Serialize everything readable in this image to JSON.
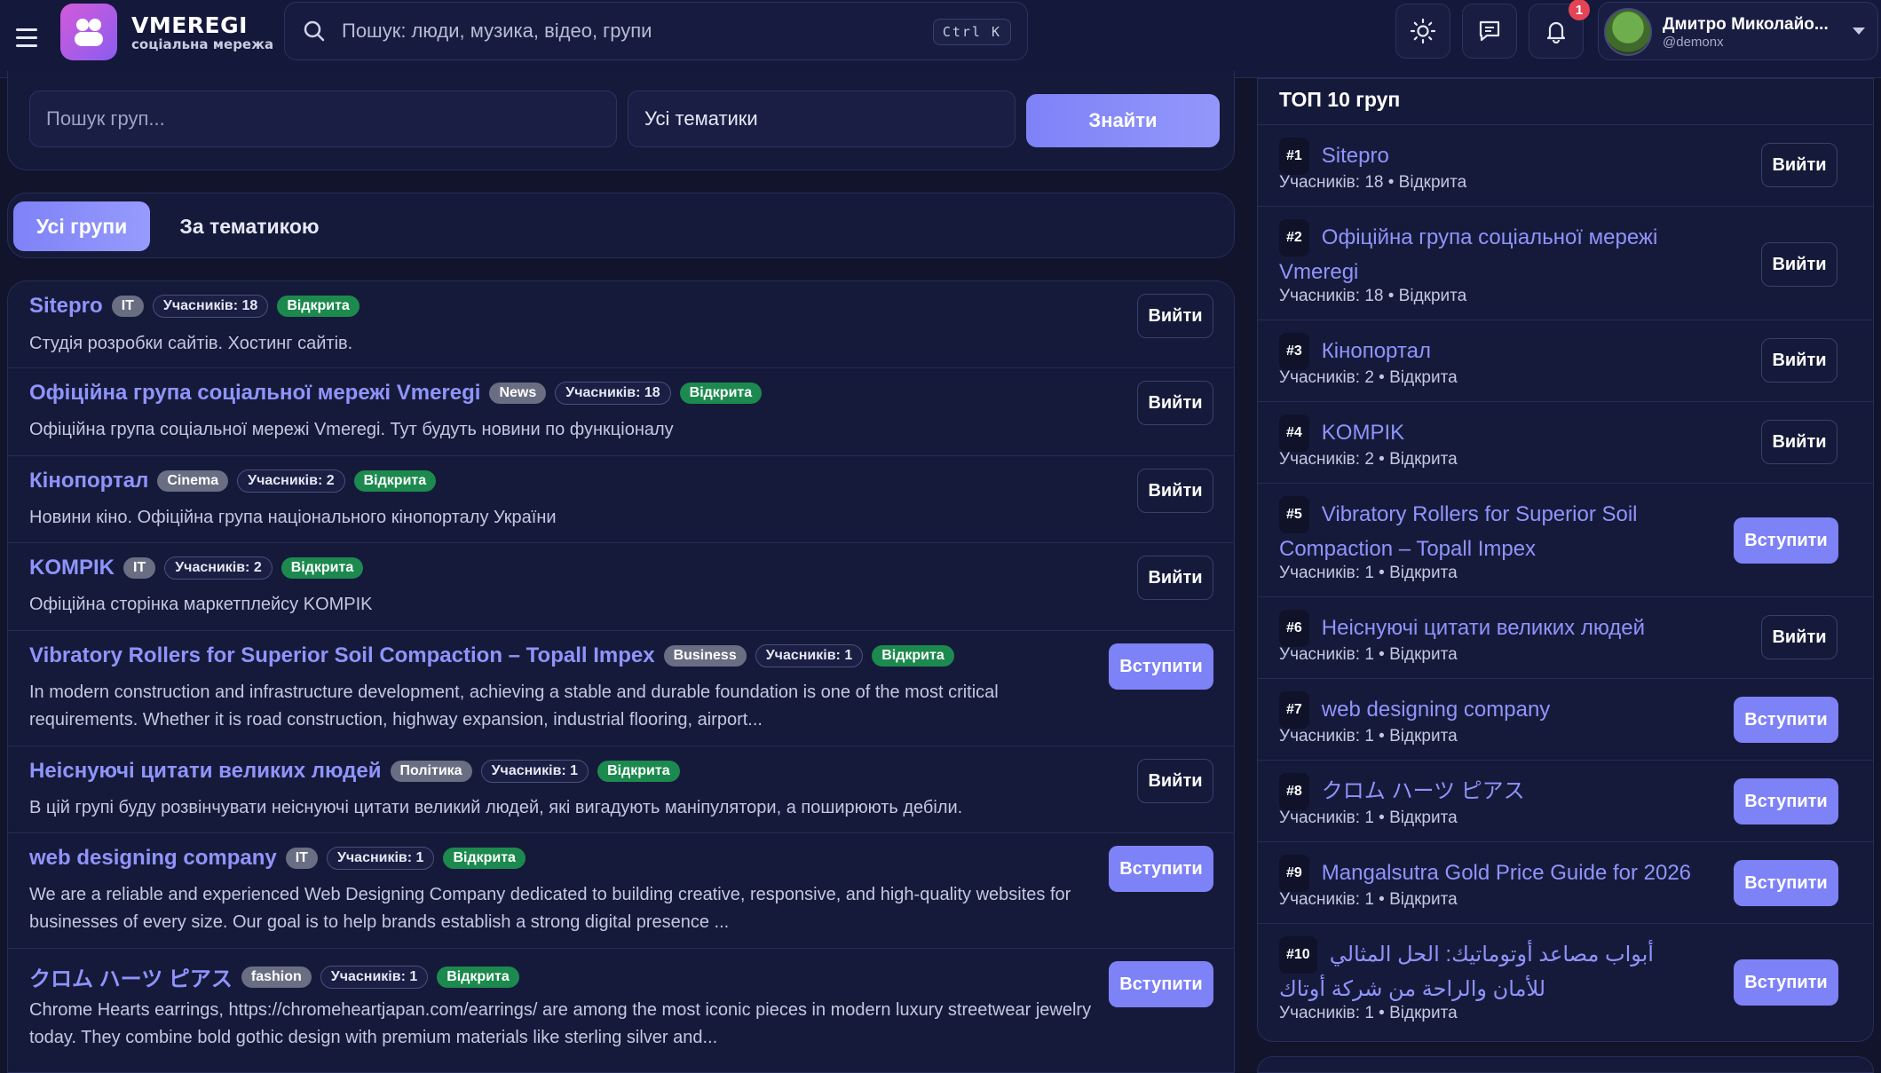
{
  "header": {
    "brand": "VMEREGI",
    "tagline": "соціальна мережа",
    "search_placeholder": "Пошук: люди, музика, відео, групи",
    "search_shortcut": "Ctrl K",
    "notification_count": "1",
    "user_name": "Дмитро Миколайо...",
    "user_handle": "@demonx"
  },
  "filters": {
    "search_placeholder": "Пошук груп...",
    "topic_selected": "Усі тематики",
    "find_label": "Знайти"
  },
  "tabs": {
    "all": "Усі групи",
    "by_topic": "За тематикою"
  },
  "groups": [
    {
      "name": "Sitepro",
      "category": "IT",
      "members": "Учасників: 18",
      "status": "Відкрита",
      "desc": "Студія розробки сайтів. Хостинг сайтів.",
      "action": "Вийти"
    },
    {
      "name": "Офіційна група соціальної мережі Vmeregi",
      "category": "News",
      "members": "Учасників: 18",
      "status": "Відкрита",
      "desc": "Офіційна група соціальної мережі Vmeregi. Тут будуть новини по функціоналу",
      "action": "Вийти"
    },
    {
      "name": "Кінопортал",
      "category": "Cinema",
      "members": "Учасників: 2",
      "status": "Відкрита",
      "desc": "Новини кіно. Офіційна група національного кінопорталу України",
      "action": "Вийти"
    },
    {
      "name": "KOMPIK",
      "category": "IT",
      "members": "Учасників: 2",
      "status": "Відкрита",
      "desc": "Офіційна сторінка маркетплейсу KOMPIK",
      "action": "Вийти"
    },
    {
      "name": "Vibratory Rollers for Superior Soil Compaction – Topall Impex",
      "category": "Business",
      "members": "Учасників: 1",
      "status": "Відкрита",
      "desc": "In modern construction and infrastructure development, achieving a stable and durable foundation is one of the most critical requirements. Whether it is road construction, highway expansion, industrial flooring, airport...",
      "action": "Вступити"
    },
    {
      "name": "Неіснуючі цитати великих людей",
      "category": "Політика",
      "members": "Учасників: 1",
      "status": "Відкрита",
      "desc": "В цій групі буду розвінчувати неіснуючі цитати великий людей, які вигадують маніпулятори, а поширюють дебіли.",
      "action": "Вийти"
    },
    {
      "name": "web designing company",
      "category": "IT",
      "members": "Учасників: 1",
      "status": "Відкрита",
      "desc": "We are a reliable and experienced Web Designing Company dedicated to building creative, responsive, and high-quality websites for businesses of every size. Our goal is to help brands establish a strong digital presence ...",
      "action": "Вступити"
    },
    {
      "name": "クロム ハーツ ピアス",
      "category": "fashion",
      "members": "Учасників: 1",
      "status": "Відкрита",
      "desc": "Chrome Hearts earrings, https://chromeheartjapan.com/earrings/ are among the most iconic pieces in modern luxury streetwear jewelry today. They combine bold gothic design with premium materials like sterling silver and...",
      "action": "Вступити"
    }
  ],
  "top": {
    "title": "ТОП 10 груп",
    "items": [
      {
        "rank": "#1",
        "name": "Sitepro",
        "meta": "Учасників: 18  •  Відкрита",
        "action": "Вийти"
      },
      {
        "rank": "#2",
        "name": "Офіційна група соціальної мережі Vmeregi",
        "meta": "Учасників: 18  •  Відкрита",
        "action": "Вийти"
      },
      {
        "rank": "#3",
        "name": "Кінопортал",
        "meta": "Учасників: 2  •  Відкрита",
        "action": "Вийти"
      },
      {
        "rank": "#4",
        "name": "KOMPIK",
        "meta": "Учасників: 2  •  Відкрита",
        "action": "Вийти"
      },
      {
        "rank": "#5",
        "name": "Vibratory Rollers for Superior Soil Compaction – Topall Impex",
        "meta": "Учасників: 1  •  Відкрита",
        "action": "Вступити"
      },
      {
        "rank": "#6",
        "name": "Неіснуючі цитати великих людей",
        "meta": "Учасників: 1  •  Відкрита",
        "action": "Вийти"
      },
      {
        "rank": "#7",
        "name": "web designing company",
        "meta": "Учасників: 1  •  Відкрита",
        "action": "Вступити"
      },
      {
        "rank": "#8",
        "name": "クロム ハーツ ピアス",
        "meta": "Учасників: 1  •  Відкрита",
        "action": "Вступити"
      },
      {
        "rank": "#9",
        "name": "Mangalsutra Gold Price Guide for 2026",
        "meta": "Учасників: 1  •  Відкрита",
        "action": "Вступити"
      },
      {
        "rank": "#10",
        "name": "أبواب مصاعد أوتوماتيك: الحل المثالي للأمان والراحة من شركة أوتاك",
        "meta": "Учасників: 1  •  Відкрита",
        "action": "Вступити"
      }
    ]
  },
  "colors": {
    "accent": "#7e82f7",
    "open_badge": "#1c8a4e",
    "background": "#11142b"
  }
}
